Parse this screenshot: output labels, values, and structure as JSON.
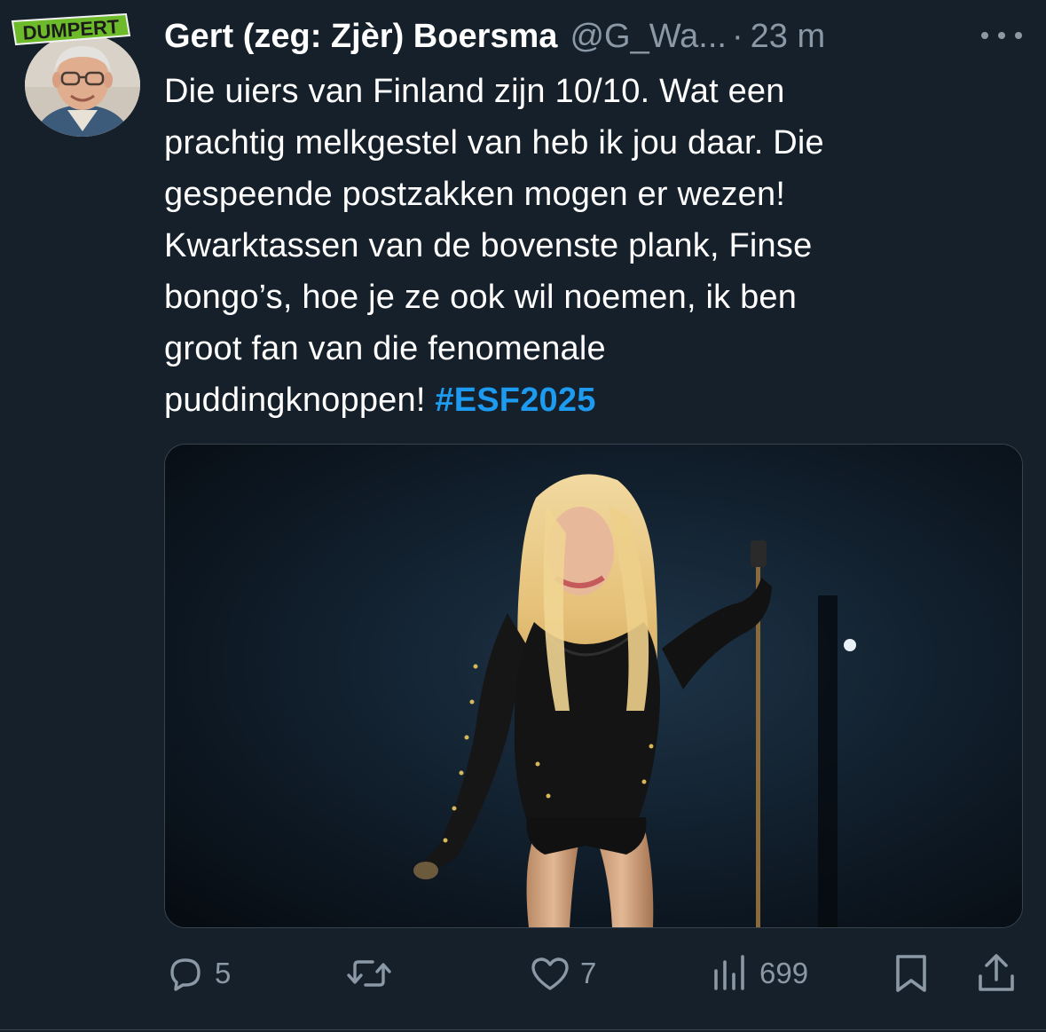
{
  "watermark": "DUMPERT",
  "author": {
    "display_name": "Gert (zeg: Zjèr) Boersma",
    "handle": "@G_Wa...",
    "separator": "·",
    "time": "23 m"
  },
  "tweet": {
    "lines": [
      "Die uiers van Finland zijn 10/10. Wat een",
      "prachtig melkgestel van heb ik jou daar. Die",
      "gespeende postzakken mogen er wezen!",
      "Kwarktassen van de bovenste plank, Finse",
      "bongo’s, hoe je ze ook wil noemen, ik ben",
      "groot fan van die fenomenale",
      "puddingknoppen!"
    ],
    "hashtag": "#ESF2025"
  },
  "actions": {
    "replies": "5",
    "retweets": "",
    "likes": "7",
    "views": "699"
  },
  "colors": {
    "background": "#15202b",
    "secondary_text": "#8b98a5",
    "link": "#1d9bf0",
    "watermark_green": "#6dbb2a"
  },
  "icons": [
    "more-icon",
    "reply-icon",
    "retweet-icon",
    "like-icon",
    "views-icon",
    "bookmark-icon",
    "share-icon"
  ]
}
